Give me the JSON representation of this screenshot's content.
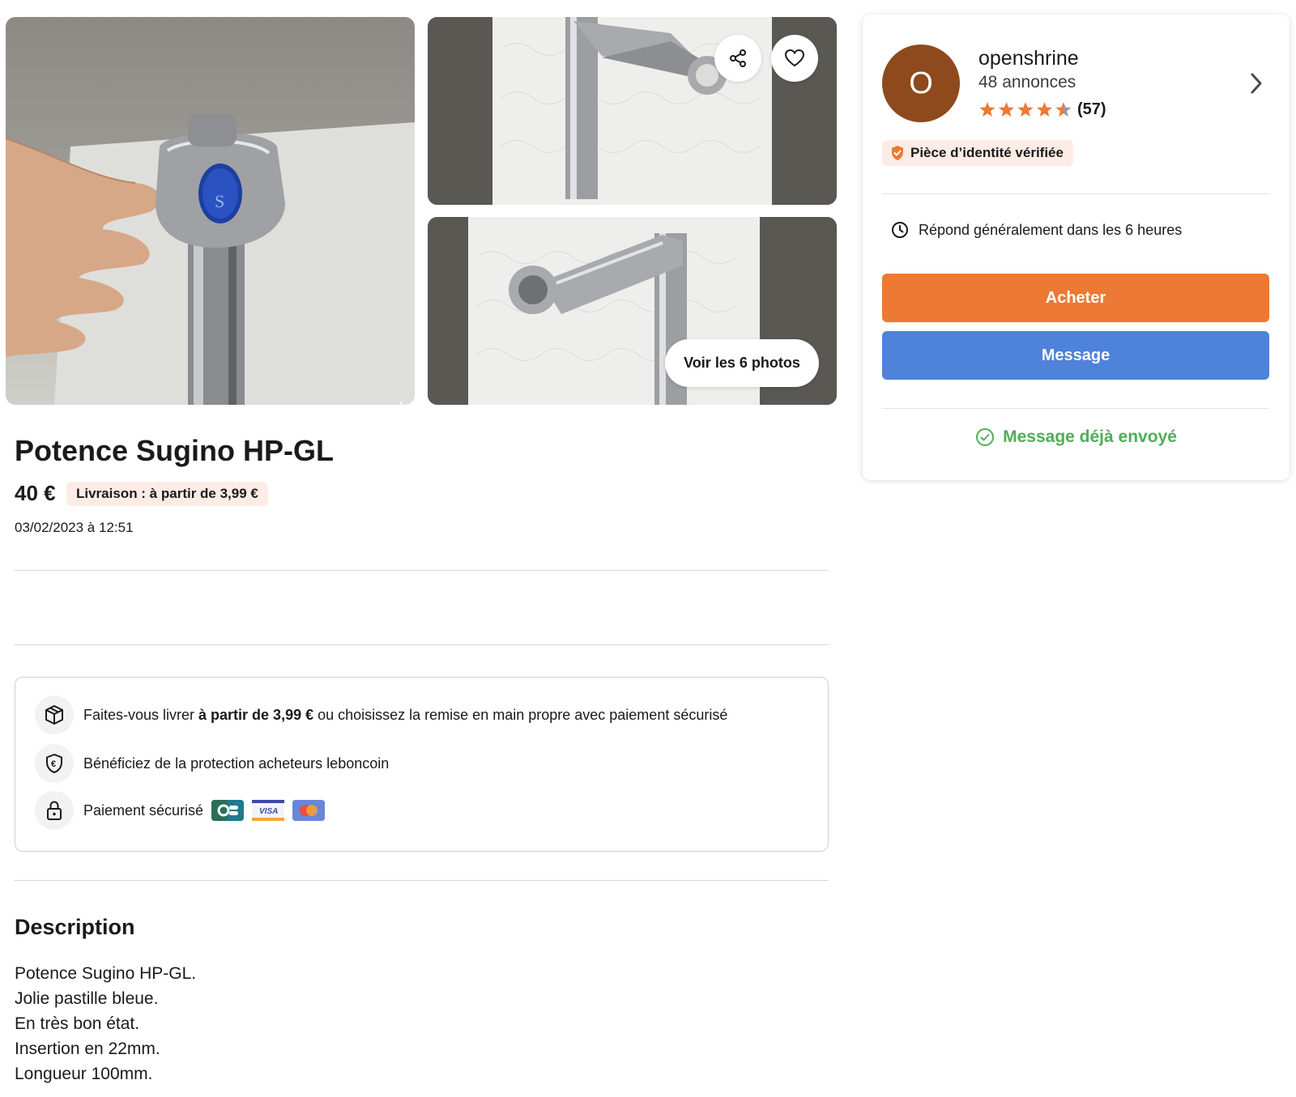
{
  "gallery": {
    "watermark": "leb",
    "see_photos_label": "Voir les 6 photos",
    "photo_count": 6
  },
  "listing": {
    "title": "Potence Sugino HP-GL",
    "price": "40 €",
    "delivery_badge": "Livraison : à partir de 3,99 €",
    "date": "03/02/2023 à 12:51"
  },
  "info": {
    "delivery_prefix": "Faites-vous livrer ",
    "delivery_bold": "à partir de 3,99 €",
    "delivery_suffix": " ou choisissez la remise en main propre avec paiement sécurisé",
    "protection": "Bénéficiez de la protection acheteurs leboncoin",
    "payment": "Paiement sécurisé",
    "card_visa": "VISA"
  },
  "description": {
    "title": "Description",
    "lines": [
      "Potence Sugino HP-GL.",
      "Jolie pastille bleue.",
      "En très bon état.",
      "Insertion en 22mm.",
      "Longueur 100mm."
    ]
  },
  "seller": {
    "avatar_letter": "O",
    "name": "openshrine",
    "listings": "48 annonces",
    "rating": 4.5,
    "rating_count": "(57)",
    "verified": "Pièce d’identité vérifiée",
    "response": "Répond généralement dans les 6 heures",
    "buy_label": "Acheter",
    "message_label": "Message",
    "sent_label": "Message déjà envoyé"
  },
  "colors": {
    "accent_orange": "#ec7a35",
    "message_blue": "#4f82d9",
    "success_green": "#4fae57",
    "avatar_brown": "#8e4a1c",
    "star_orange": "#ec7a35"
  },
  "icons": {
    "share": "share-icon",
    "favorite": "heart-icon",
    "chevron": "chevron-right-icon",
    "verified": "shield-check-icon",
    "response": "clock-icon",
    "sent": "check-circle-icon",
    "delivery": "package-icon",
    "protection": "shield-euro-icon",
    "payment": "lock-icon"
  }
}
